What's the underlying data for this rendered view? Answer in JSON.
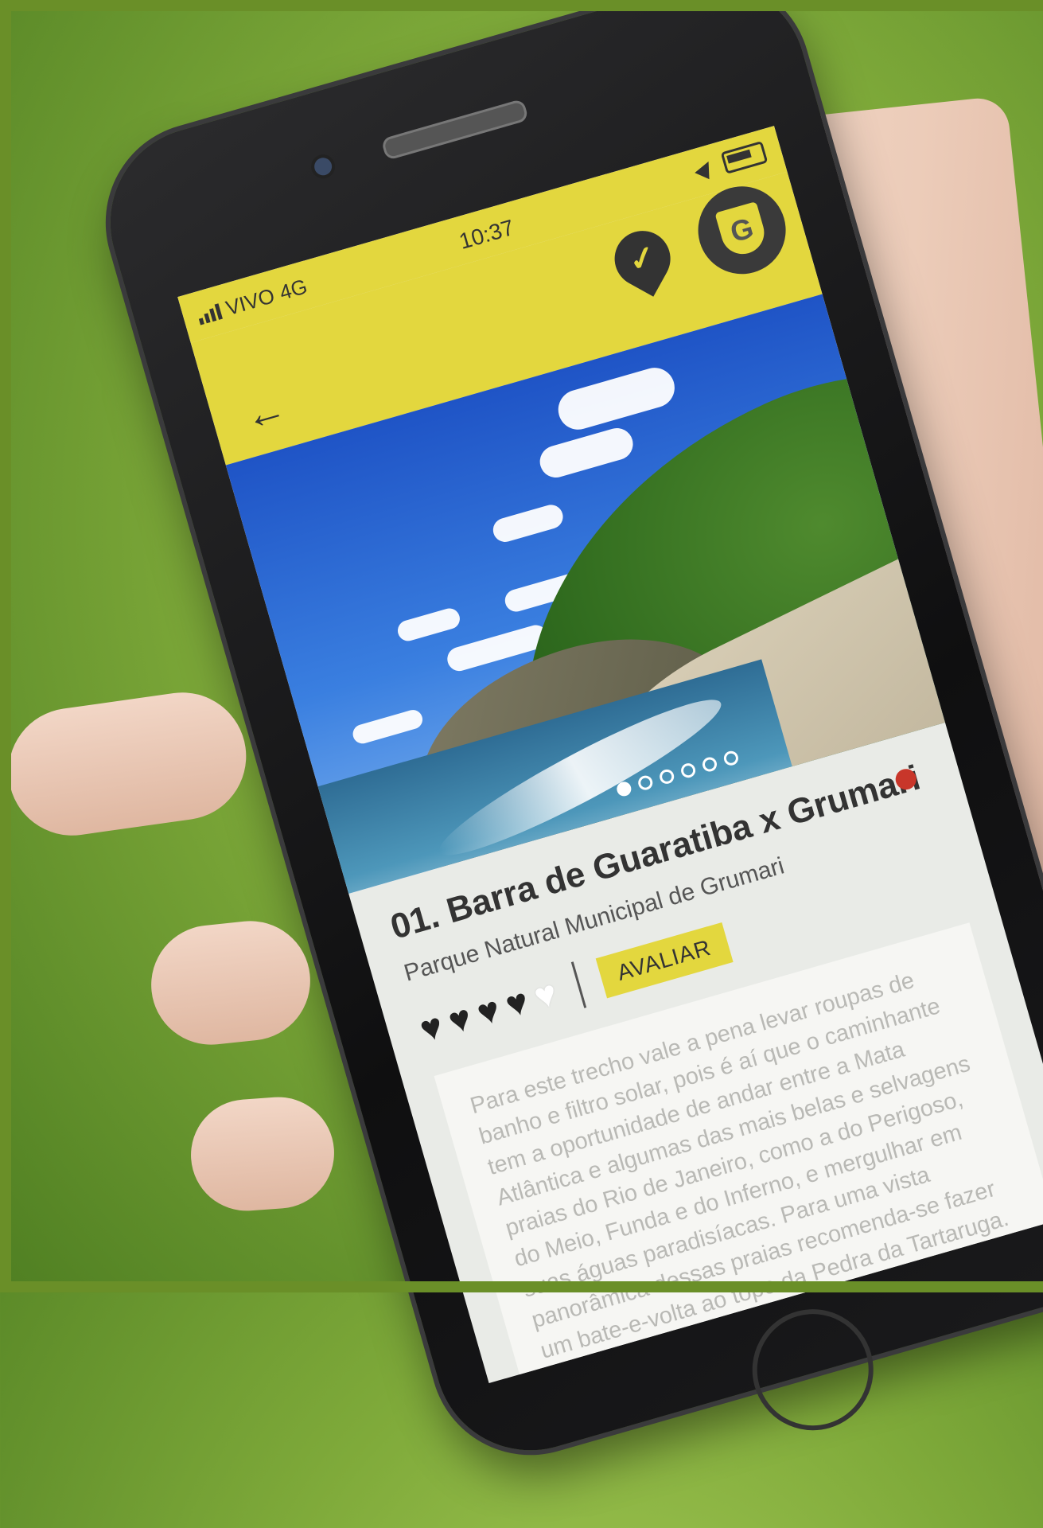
{
  "status_bar": {
    "carrier": "VIVO",
    "network": "4G",
    "time": "10:37"
  },
  "app_bar": {
    "back_icon": "arrow-left-icon",
    "check_icon": "check-pin-icon",
    "badge_letter": "G"
  },
  "hero": {
    "carousel_total": 6,
    "carousel_active": 1
  },
  "trail": {
    "title": "01. Barra de Guaratiba x Grumari",
    "subtitle": "Parque Natural Municipal de Grumari",
    "status_color": "#c8362a",
    "rating_filled": 4,
    "rating_max": 5,
    "rate_button": "AVALIAR",
    "description": "Para este trecho vale a pena levar roupas de banho e filtro solar, pois é aí que o caminhante tem a oportunidade de andar entre a Mata Atlântica e algumas das mais belas e selvagens praias do Rio de Janeiro, como a do Perigoso, do Meio, Funda e do Inferno, e mergulhar em suas águas paradisíacas. Para uma vista panorâmica dessas praias recomenda-se fazer um bate-e-volta ao topo da Pedra da Tartaruga. Outra vista imperdível é da Pedra do Telégrafo, que já ganhou fama nas redes sociais e é um dos principais atrativos do trecho. Mas tome cuidado e saiba que o local pode ficar ... dias de sol, especialmente nos fins de ... é possível avistar de um lado a"
  },
  "colors": {
    "accent": "#e3d73e",
    "text_dark": "#333333",
    "background": "#e9ebe7"
  }
}
